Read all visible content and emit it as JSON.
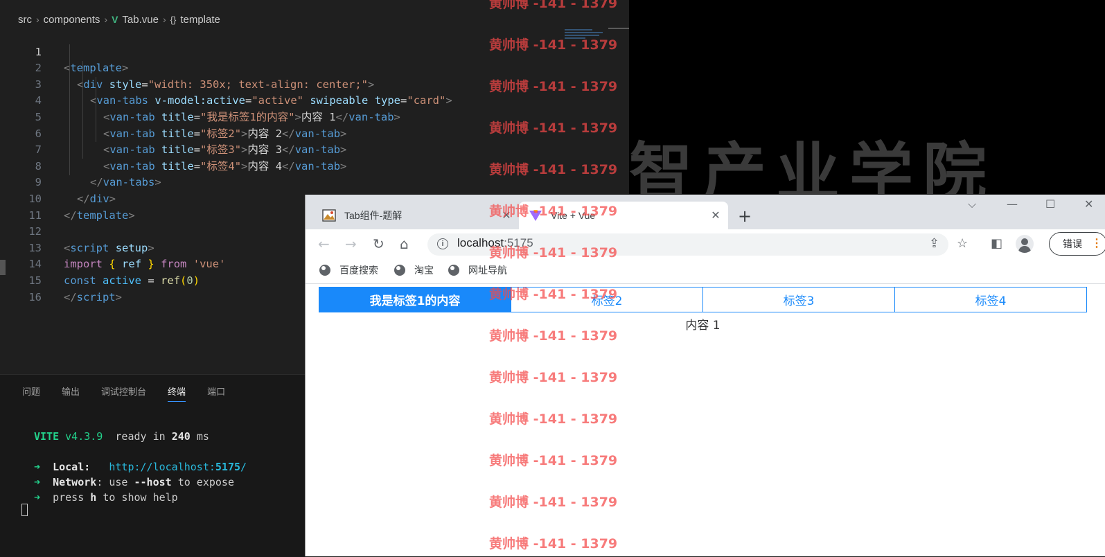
{
  "editor": {
    "breadcrumb": {
      "parts": [
        "src",
        "components",
        "Tab.vue",
        "template"
      ]
    },
    "line_numbers": [
      "1",
      "2",
      "3",
      "4",
      "5",
      "6",
      "7",
      "8",
      "9",
      "10",
      "11",
      "12",
      "13",
      "14",
      "15",
      "16"
    ],
    "code": {
      "l1": {
        "open": "<",
        "tag": "template",
        "close": ">"
      },
      "l2": {
        "open": "<",
        "tag": "div",
        "attr": "style",
        "eq": "=",
        "val": "\"width: 350x; text-align: center;\"",
        "close": ">"
      },
      "l3": {
        "open": "<",
        "tag": "van-tabs",
        "attr1": "v-model:active",
        "eq1": "=",
        "val1": "\"active\"",
        "attr2": "swipeable",
        "attr3": "type",
        "eq3": "=",
        "val3": "\"card\"",
        "close": ">"
      },
      "tabs": [
        {
          "open": "<",
          "tag": "van-tab",
          "attr": "title",
          "eq": "=",
          "val": "\"我是标签1的内容\"",
          "gt": ">",
          "text": "内容 1",
          "endopen": "</",
          "endtag": "van-tab",
          "endclose": ">"
        },
        {
          "open": "<",
          "tag": "van-tab",
          "attr": "title",
          "eq": "=",
          "val": "\"标签2\"",
          "gt": ">",
          "text": "内容 2",
          "endopen": "</",
          "endtag": "van-tab",
          "endclose": ">"
        },
        {
          "open": "<",
          "tag": "van-tab",
          "attr": "title",
          "eq": "=",
          "val": "\"标签3\"",
          "gt": ">",
          "text": "内容 3",
          "endopen": "</",
          "endtag": "van-tab",
          "endclose": ">"
        },
        {
          "open": "<",
          "tag": "van-tab",
          "attr": "title",
          "eq": "=",
          "val": "\"标签4\"",
          "gt": ">",
          "text": "内容 4",
          "endopen": "</",
          "endtag": "van-tab",
          "endclose": ">"
        }
      ],
      "l8": {
        "open": "</",
        "tag": "van-tabs",
        "close": ">"
      },
      "l9": {
        "open": "</",
        "tag": "div",
        "close": ">"
      },
      "l10": {
        "open": "</",
        "tag": "template",
        "close": ">"
      },
      "l12": {
        "open": "<",
        "tag": "script",
        "attr": "setup",
        "close": ">"
      },
      "l13": {
        "kw1": "import",
        "lb": "{",
        "name": "ref",
        "rb": "}",
        "kw2": "from",
        "str": "'vue'"
      },
      "l14": {
        "decl": "const",
        "var": "active",
        "eq": "=",
        "fn": "ref",
        "lp": "(",
        "num": "0",
        "rp": ")"
      },
      "l15": {
        "open": "</",
        "tag": "script",
        "close": ">"
      }
    }
  },
  "background_watermark": "智产业学院",
  "watermark_text": "黄帅博 -141 - 1379",
  "panel": {
    "tabs": [
      "问题",
      "输出",
      "调试控制台",
      "终端",
      "端口"
    ],
    "terminal": {
      "vite": "VITE",
      "version": "v4.3.9",
      "ready": "ready in",
      "ms_value": "240",
      "ms_unit": "ms",
      "arrow": "➜",
      "local_label": "Local:",
      "local_url_prefix": "http://localhost:",
      "local_port": "5175",
      "local_url_suffix": "/",
      "network_label": "Network",
      "network_text1": ": use",
      "network_flag": "--host",
      "network_text2": "to expose",
      "help_text1": "press",
      "help_key": "h",
      "help_text2": "to show help"
    }
  },
  "browser": {
    "tabs": [
      {
        "title": "Tab组件-题解",
        "close": "✕"
      },
      {
        "title": "Vite + Vue",
        "close": "✕"
      }
    ],
    "new_tab": "+",
    "window_buttons": [
      "⌵",
      "—",
      "☐",
      "✕"
    ],
    "nav": {
      "back": "←",
      "forward": "→",
      "reload": "↻",
      "home": "⌂"
    },
    "address": {
      "info": "i",
      "host": "localhost",
      "port": ":5175"
    },
    "toolbar_icons": {
      "share": "⇪",
      "star": "☆",
      "sidepanel": "◧"
    },
    "error_button": "错误",
    "error_dots": "⋮",
    "bookmarks": [
      "百度搜索",
      "淘宝",
      "网址导航"
    ],
    "page": {
      "tabs": [
        "我是标签1的内容",
        "标签2",
        "标签3",
        "标签4"
      ],
      "active_tab_index": 0,
      "content": "内容 1"
    },
    "accent_color": "#1989fa"
  }
}
